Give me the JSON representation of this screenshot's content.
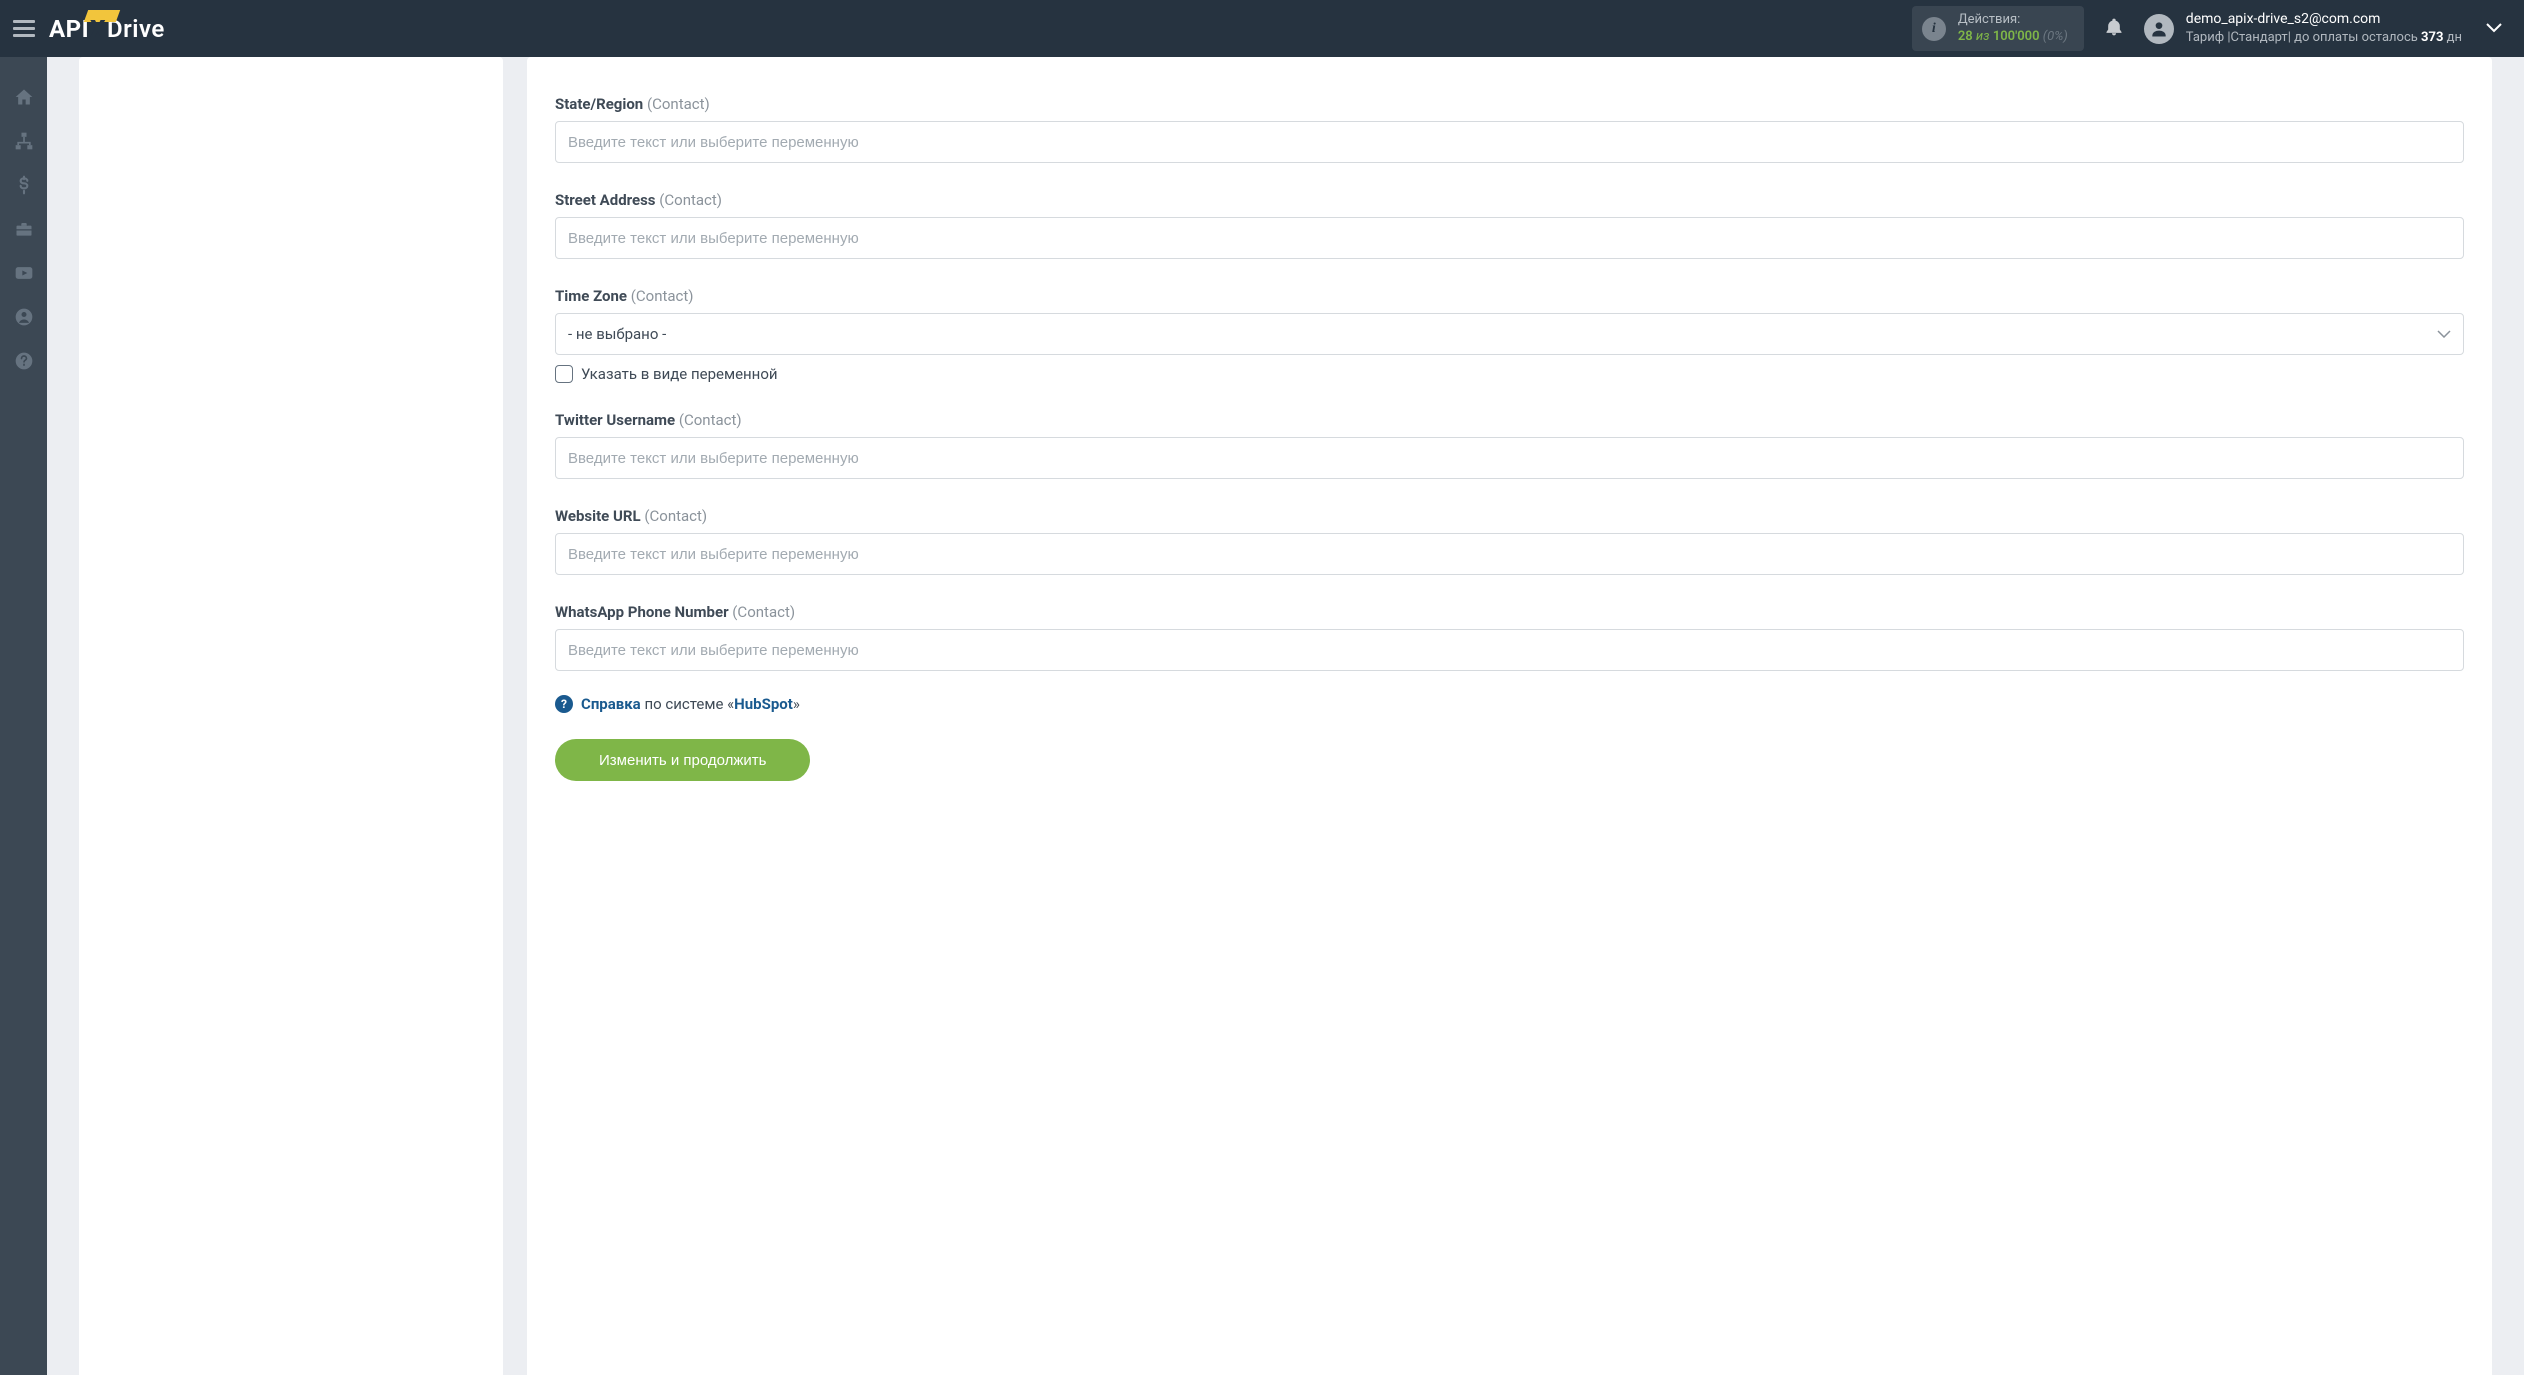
{
  "header": {
    "logo_api": "API",
    "logo_x": "X",
    "logo_drive": "Drive",
    "actions_label": "Действия:",
    "actions_count": "28",
    "actions_iz": "из",
    "actions_total": "100'000",
    "actions_pct": "(0%)",
    "user_email": "demo_apix-drive_s2@com.com",
    "tariff_prefix": "Тариф |",
    "tariff_name": "Стандарт",
    "tariff_sep": "|",
    "tariff_rest_pre": " до оплаты осталось ",
    "tariff_days": "373",
    "tariff_dn": " дн"
  },
  "form": {
    "placeholder": "Введите текст или выберите переменную",
    "fields": [
      {
        "label": "State/Region",
        "suffix": "(Contact)",
        "type": "text"
      },
      {
        "label": "Street Address",
        "suffix": "(Contact)",
        "type": "text"
      },
      {
        "label": "Time Zone",
        "suffix": "(Contact)",
        "type": "select",
        "selected": "- не выбрано -",
        "checkbox": "Указать в виде переменной"
      },
      {
        "label": "Twitter Username",
        "suffix": "(Contact)",
        "type": "text"
      },
      {
        "label": "Website URL",
        "suffix": "(Contact)",
        "type": "text"
      },
      {
        "label": "WhatsApp Phone Number",
        "suffix": "(Contact)",
        "type": "text"
      }
    ],
    "help_label": "Справка",
    "help_system": " по системе «",
    "help_hub": "HubSpot",
    "help_close": "»",
    "submit": "Изменить и продолжить"
  }
}
